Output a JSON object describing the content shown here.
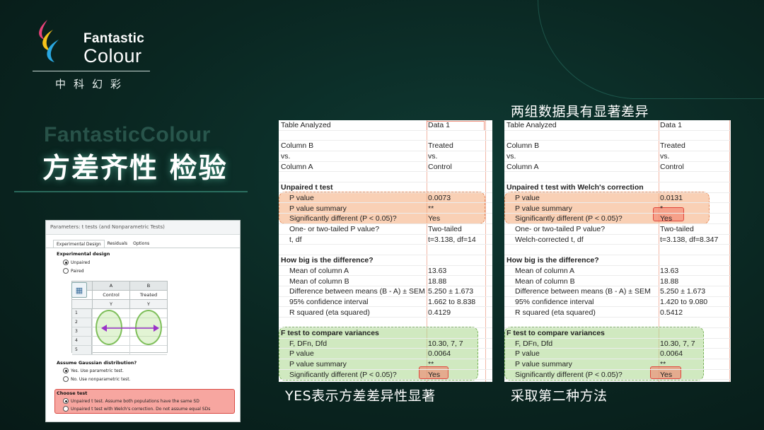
{
  "brand": {
    "name_line1": "Fantastic",
    "name_line2": "Colour",
    "name_cn": "中科幻彩"
  },
  "headline": {
    "ghost": "FantasticColour",
    "title": "方差齐性 检验"
  },
  "captions": {
    "top_right": "两组数据具有显著差异",
    "bottom_left": "YES表示方差差异性显著",
    "bottom_right": "采取第二种方法"
  },
  "dialog": {
    "title": "Parameters: t tests (and Nonparametric Tests)",
    "tabs": [
      "Experimental Design",
      "Residuals",
      "Options"
    ],
    "experimental_design_label": "Experimental design",
    "unpaired_label": "Unpaired",
    "paired_label": "Paired",
    "grid_headers": [
      "A",
      "B"
    ],
    "grid_subheaders": [
      "Control",
      "Treated"
    ],
    "grid_y": [
      "Y",
      "Y"
    ],
    "row_numbers": [
      "1",
      "2",
      "3",
      "4",
      "5"
    ],
    "gaussian_label": "Assume Gaussian distribution?",
    "gaussian_yes": "Yes. Use parametric test.",
    "gaussian_no": "No. Use nonparametric test.",
    "choose_test_label": "Choose test",
    "choose_option1": "Unpaired t test. Assume both populations have the same SD",
    "choose_option2": "Unpaired t test with Welch's correction. Do not assume equal SDs"
  },
  "results_a": {
    "rows": [
      {
        "label": "Table Analyzed",
        "value": "Data 1",
        "style": "plain"
      },
      {
        "label": "",
        "value": "",
        "style": "plain"
      },
      {
        "label": "Column B",
        "value": "Treated",
        "style": "plain"
      },
      {
        "label": "vs.",
        "value": "vs.",
        "style": "plain"
      },
      {
        "label": "Column A",
        "value": "Control",
        "style": "plain"
      },
      {
        "label": "",
        "value": "",
        "style": "plain"
      },
      {
        "label": "Unpaired t test",
        "value": "",
        "style": "bold"
      },
      {
        "label": "P value",
        "value": "0.0073",
        "style": "ind"
      },
      {
        "label": "P value summary",
        "value": "**",
        "style": "ind"
      },
      {
        "label": "Significantly different (P < 0.05)?",
        "value": "Yes",
        "style": "ind"
      },
      {
        "label": "One- or two-tailed P value?",
        "value": "Two-tailed",
        "style": "ind"
      },
      {
        "label": "t, df",
        "value": "t=3.138, df=14",
        "style": "ind"
      },
      {
        "label": "",
        "value": "",
        "style": "plain"
      },
      {
        "label": "How big is the difference?",
        "value": "",
        "style": "bold"
      },
      {
        "label": "Mean of column A",
        "value": "13.63",
        "style": "ind"
      },
      {
        "label": "Mean of column B",
        "value": "18.88",
        "style": "ind"
      },
      {
        "label": "Difference between means (B - A) ± SEM",
        "value": "5.250 ± 1.673",
        "style": "ind"
      },
      {
        "label": "95% confidence interval",
        "value": "1.662 to 8.838",
        "style": "ind"
      },
      {
        "label": "R squared (eta squared)",
        "value": "0.4129",
        "style": "ind"
      },
      {
        "label": "",
        "value": "",
        "style": "plain"
      },
      {
        "label": "F test to compare variances",
        "value": "",
        "style": "bold"
      },
      {
        "label": "F, DFn, Dfd",
        "value": "10.30, 7, 7",
        "style": "ind"
      },
      {
        "label": "P value",
        "value": "0.0064",
        "style": "ind"
      },
      {
        "label": "P value summary",
        "value": "**",
        "style": "ind"
      },
      {
        "label": "Significantly different (P < 0.05)?",
        "value": "Yes",
        "style": "ind"
      }
    ]
  },
  "results_b": {
    "rows": [
      {
        "label": "Table Analyzed",
        "value": "Data 1",
        "style": "plain"
      },
      {
        "label": "",
        "value": "",
        "style": "plain"
      },
      {
        "label": "Column B",
        "value": "Treated",
        "style": "plain"
      },
      {
        "label": "vs.",
        "value": "vs.",
        "style": "plain"
      },
      {
        "label": "Column A",
        "value": "Control",
        "style": "plain"
      },
      {
        "label": "",
        "value": "",
        "style": "plain"
      },
      {
        "label": "Unpaired t test with Welch's correction",
        "value": "",
        "style": "bold"
      },
      {
        "label": "P value",
        "value": "0.0131",
        "style": "ind"
      },
      {
        "label": "P value summary",
        "value": "*",
        "style": "ind"
      },
      {
        "label": "Significantly different (P < 0.05)?",
        "value": "Yes",
        "style": "ind"
      },
      {
        "label": "One- or two-tailed P value?",
        "value": "Two-tailed",
        "style": "ind"
      },
      {
        "label": "Welch-corrected  t, df",
        "value": "t=3.138, df=8.347",
        "style": "ind"
      },
      {
        "label": "",
        "value": "",
        "style": "plain"
      },
      {
        "label": "How big is the difference?",
        "value": "",
        "style": "bold"
      },
      {
        "label": "Mean of column A",
        "value": "13.63",
        "style": "ind"
      },
      {
        "label": "Mean of column B",
        "value": "18.88",
        "style": "ind"
      },
      {
        "label": "Difference between means (B - A) ± SEM",
        "value": "5.250 ± 1.673",
        "style": "ind"
      },
      {
        "label": "95% confidence interval",
        "value": "1.420 to 9.080",
        "style": "ind"
      },
      {
        "label": "R squared (eta squared)",
        "value": "0.5412",
        "style": "ind"
      },
      {
        "label": "",
        "value": "",
        "style": "plain"
      },
      {
        "label": "F test to compare variances",
        "value": "",
        "style": "bold"
      },
      {
        "label": "F, DFn, Dfd",
        "value": "10.30, 7, 7",
        "style": "ind"
      },
      {
        "label": "P value",
        "value": "0.0064",
        "style": "ind"
      },
      {
        "label": "P value summary",
        "value": "**",
        "style": "ind"
      },
      {
        "label": "Significantly different (P < 0.05)?",
        "value": "Yes",
        "style": "ind"
      }
    ]
  },
  "colors": {
    "background": "#0a2621",
    "highlight_orange": "#f4aa78",
    "highlight_green": "#aad78c",
    "yes_box": "#e0483e"
  }
}
